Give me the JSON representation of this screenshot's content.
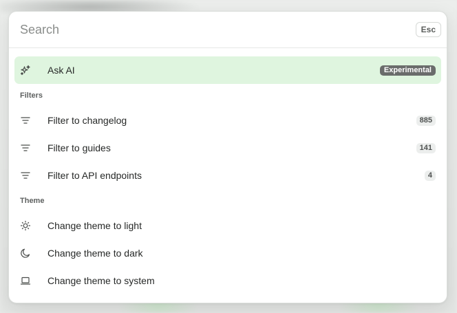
{
  "search": {
    "placeholder": "Search",
    "esc_label": "Esc"
  },
  "ask_ai": {
    "label": "Ask AI",
    "badge": "Experimental",
    "icon": "sparkles-icon"
  },
  "filters": {
    "heading": "Filters",
    "items": [
      {
        "label": "Filter to changelog",
        "count": "885",
        "icon": "filter-icon"
      },
      {
        "label": "Filter to guides",
        "count": "141",
        "icon": "filter-icon"
      },
      {
        "label": "Filter to API endpoints",
        "count": "4",
        "icon": "filter-icon"
      }
    ]
  },
  "theme": {
    "heading": "Theme",
    "items": [
      {
        "label": "Change theme to light",
        "icon": "sun-icon"
      },
      {
        "label": "Change theme to dark",
        "icon": "moon-icon"
      },
      {
        "label": "Change theme to system",
        "icon": "laptop-icon"
      }
    ]
  },
  "colors": {
    "active_background": "#dff5df",
    "badge_background": "#6a6c6b",
    "count_background": "#eceeed"
  }
}
